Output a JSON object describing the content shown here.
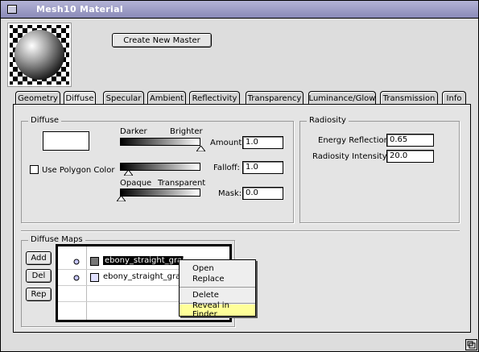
{
  "window": {
    "title": "Mesh10 Material"
  },
  "toolbar": {
    "create_master_label": "Create New Master"
  },
  "tabs": [
    {
      "label": "Geometry"
    },
    {
      "label": "Diffuse"
    },
    {
      "label": "Specular"
    },
    {
      "label": "Ambient"
    },
    {
      "label": "Reflectivity"
    },
    {
      "label": "Transparency"
    },
    {
      "label": "Luminance/Glow"
    },
    {
      "label": "Transmission"
    },
    {
      "label": "Info"
    }
  ],
  "active_tab": "Diffuse",
  "diffuse": {
    "group_label": "Diffuse",
    "darker_label": "Darker",
    "brighter_label": "Brighter",
    "amount_label": "Amount:",
    "amount_value": "1.0",
    "use_polygon_color_label": "Use Polygon Color",
    "use_polygon_color_checked": false,
    "falloff_label": "Falloff:",
    "falloff_value": "1.0",
    "opaque_label": "Opaque",
    "transparent_label": "Transparent",
    "mask_label": "Mask:",
    "mask_value": "0.0",
    "color_swatch": "#ffffff"
  },
  "radiosity": {
    "group_label": "Radiosity",
    "energy_reflection_label": "Energy Reflection:",
    "energy_reflection_value": "0.65",
    "radiosity_intensity_label": "Radiosity Intensity:",
    "radiosity_intensity_value": "20.0"
  },
  "diffuse_maps": {
    "group_label": "Diffuse Maps",
    "add_label": "Add",
    "del_label": "Del",
    "rep_label": "Rep",
    "items": [
      {
        "name": "ebony_straight_grain.tif",
        "selected": true
      },
      {
        "name": "ebony_straight_grain.tif",
        "selected": false
      }
    ]
  },
  "context_menu": {
    "items": [
      "Open",
      "Replace",
      "Delete",
      "Reveal in Finder"
    ],
    "highlighted": "Reveal in Finder"
  },
  "colors": {
    "titlebar": "#8a8ab8",
    "menu_highlight": "#ffff99",
    "selection": "#000000"
  }
}
